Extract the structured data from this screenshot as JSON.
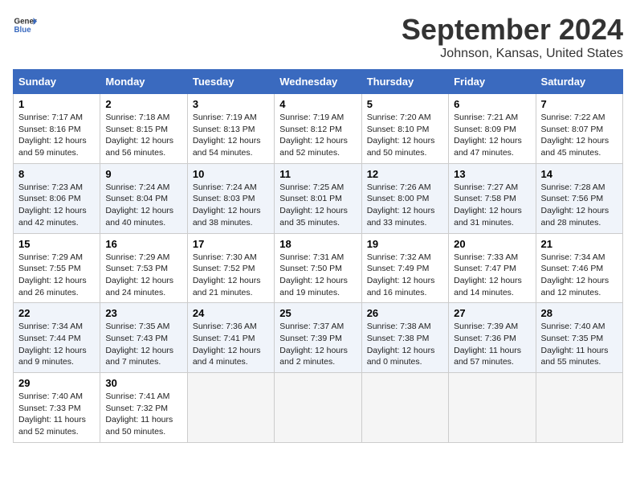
{
  "header": {
    "logo_general": "General",
    "logo_blue": "Blue",
    "title": "September 2024",
    "subtitle": "Johnson, Kansas, United States"
  },
  "days_of_week": [
    "Sunday",
    "Monday",
    "Tuesday",
    "Wednesday",
    "Thursday",
    "Friday",
    "Saturday"
  ],
  "weeks": [
    [
      {
        "day": 1,
        "content": "Sunrise: 7:17 AM\nSunset: 8:16 PM\nDaylight: 12 hours and 59 minutes."
      },
      {
        "day": 2,
        "content": "Sunrise: 7:18 AM\nSunset: 8:15 PM\nDaylight: 12 hours and 56 minutes."
      },
      {
        "day": 3,
        "content": "Sunrise: 7:19 AM\nSunset: 8:13 PM\nDaylight: 12 hours and 54 minutes."
      },
      {
        "day": 4,
        "content": "Sunrise: 7:19 AM\nSunset: 8:12 PM\nDaylight: 12 hours and 52 minutes."
      },
      {
        "day": 5,
        "content": "Sunrise: 7:20 AM\nSunset: 8:10 PM\nDaylight: 12 hours and 50 minutes."
      },
      {
        "day": 6,
        "content": "Sunrise: 7:21 AM\nSunset: 8:09 PM\nDaylight: 12 hours and 47 minutes."
      },
      {
        "day": 7,
        "content": "Sunrise: 7:22 AM\nSunset: 8:07 PM\nDaylight: 12 hours and 45 minutes."
      }
    ],
    [
      {
        "day": 8,
        "content": "Sunrise: 7:23 AM\nSunset: 8:06 PM\nDaylight: 12 hours and 42 minutes."
      },
      {
        "day": 9,
        "content": "Sunrise: 7:24 AM\nSunset: 8:04 PM\nDaylight: 12 hours and 40 minutes."
      },
      {
        "day": 10,
        "content": "Sunrise: 7:24 AM\nSunset: 8:03 PM\nDaylight: 12 hours and 38 minutes."
      },
      {
        "day": 11,
        "content": "Sunrise: 7:25 AM\nSunset: 8:01 PM\nDaylight: 12 hours and 35 minutes."
      },
      {
        "day": 12,
        "content": "Sunrise: 7:26 AM\nSunset: 8:00 PM\nDaylight: 12 hours and 33 minutes."
      },
      {
        "day": 13,
        "content": "Sunrise: 7:27 AM\nSunset: 7:58 PM\nDaylight: 12 hours and 31 minutes."
      },
      {
        "day": 14,
        "content": "Sunrise: 7:28 AM\nSunset: 7:56 PM\nDaylight: 12 hours and 28 minutes."
      }
    ],
    [
      {
        "day": 15,
        "content": "Sunrise: 7:29 AM\nSunset: 7:55 PM\nDaylight: 12 hours and 26 minutes."
      },
      {
        "day": 16,
        "content": "Sunrise: 7:29 AM\nSunset: 7:53 PM\nDaylight: 12 hours and 24 minutes."
      },
      {
        "day": 17,
        "content": "Sunrise: 7:30 AM\nSunset: 7:52 PM\nDaylight: 12 hours and 21 minutes."
      },
      {
        "day": 18,
        "content": "Sunrise: 7:31 AM\nSunset: 7:50 PM\nDaylight: 12 hours and 19 minutes."
      },
      {
        "day": 19,
        "content": "Sunrise: 7:32 AM\nSunset: 7:49 PM\nDaylight: 12 hours and 16 minutes."
      },
      {
        "day": 20,
        "content": "Sunrise: 7:33 AM\nSunset: 7:47 PM\nDaylight: 12 hours and 14 minutes."
      },
      {
        "day": 21,
        "content": "Sunrise: 7:34 AM\nSunset: 7:46 PM\nDaylight: 12 hours and 12 minutes."
      }
    ],
    [
      {
        "day": 22,
        "content": "Sunrise: 7:34 AM\nSunset: 7:44 PM\nDaylight: 12 hours and 9 minutes."
      },
      {
        "day": 23,
        "content": "Sunrise: 7:35 AM\nSunset: 7:43 PM\nDaylight: 12 hours and 7 minutes."
      },
      {
        "day": 24,
        "content": "Sunrise: 7:36 AM\nSunset: 7:41 PM\nDaylight: 12 hours and 4 minutes."
      },
      {
        "day": 25,
        "content": "Sunrise: 7:37 AM\nSunset: 7:39 PM\nDaylight: 12 hours and 2 minutes."
      },
      {
        "day": 26,
        "content": "Sunrise: 7:38 AM\nSunset: 7:38 PM\nDaylight: 12 hours and 0 minutes."
      },
      {
        "day": 27,
        "content": "Sunrise: 7:39 AM\nSunset: 7:36 PM\nDaylight: 11 hours and 57 minutes."
      },
      {
        "day": 28,
        "content": "Sunrise: 7:40 AM\nSunset: 7:35 PM\nDaylight: 11 hours and 55 minutes."
      }
    ],
    [
      {
        "day": 29,
        "content": "Sunrise: 7:40 AM\nSunset: 7:33 PM\nDaylight: 11 hours and 52 minutes."
      },
      {
        "day": 30,
        "content": "Sunrise: 7:41 AM\nSunset: 7:32 PM\nDaylight: 11 hours and 50 minutes."
      },
      {
        "day": null,
        "content": ""
      },
      {
        "day": null,
        "content": ""
      },
      {
        "day": null,
        "content": ""
      },
      {
        "day": null,
        "content": ""
      },
      {
        "day": null,
        "content": ""
      }
    ]
  ]
}
